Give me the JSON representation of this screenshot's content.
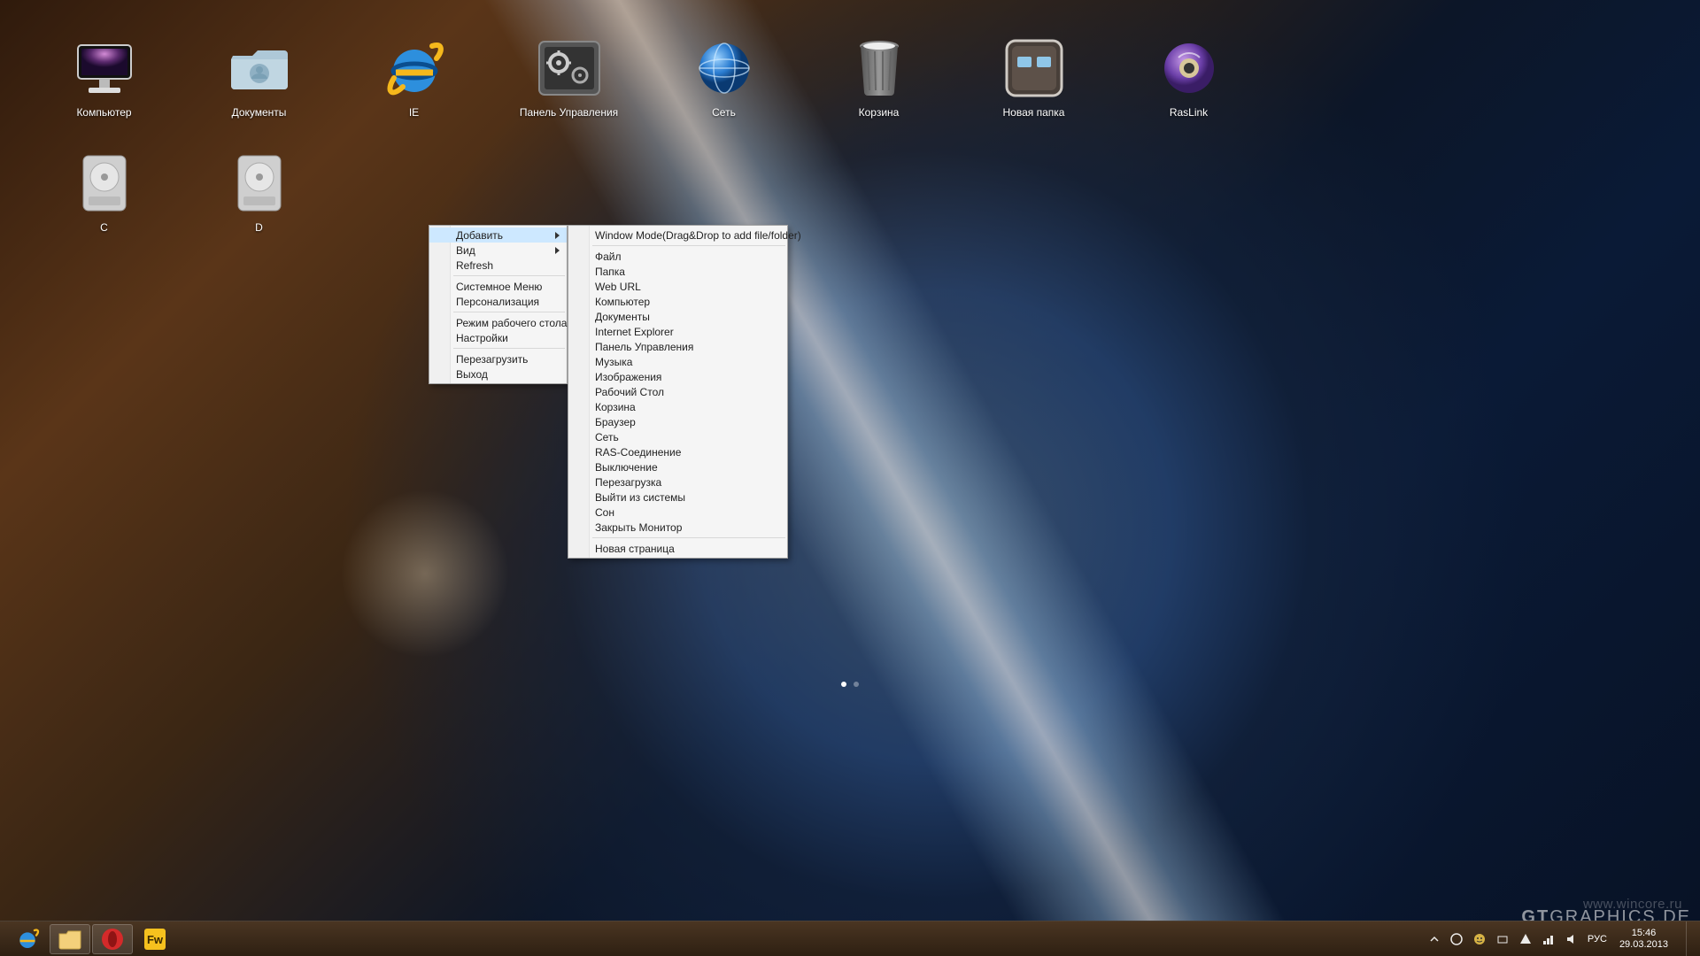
{
  "desktop_icons": {
    "row1": [
      {
        "name": "computer",
        "label": "Компьютер"
      },
      {
        "name": "documents",
        "label": "Документы"
      },
      {
        "name": "ie",
        "label": "IE"
      },
      {
        "name": "control-panel",
        "label": "Панель Управления"
      },
      {
        "name": "network",
        "label": "Сеть"
      },
      {
        "name": "trash",
        "label": "Корзина"
      },
      {
        "name": "new-folder",
        "label": "Новая папка"
      },
      {
        "name": "raslink",
        "label": "RasLink"
      }
    ],
    "row2": [
      {
        "name": "drive-c",
        "label": "C"
      },
      {
        "name": "drive-d",
        "label": "D"
      }
    ]
  },
  "context_menu": {
    "items": [
      {
        "label": "Добавить",
        "submenu": true,
        "highlight": true
      },
      {
        "label": "Вид",
        "submenu": true
      },
      {
        "label": "Refresh"
      },
      {
        "sep": true
      },
      {
        "label": "Системное Меню"
      },
      {
        "label": "Персонализация"
      },
      {
        "sep": true
      },
      {
        "label": "Режим рабочего стола"
      },
      {
        "label": "Настройки"
      },
      {
        "sep": true
      },
      {
        "label": "Перезагрузить"
      },
      {
        "label": "Выход"
      }
    ]
  },
  "submenu": {
    "items": [
      {
        "label": "Window Mode(Drag&Drop to add file/folder)"
      },
      {
        "sep": true
      },
      {
        "label": "Файл"
      },
      {
        "label": "Папка"
      },
      {
        "label": "Web URL"
      },
      {
        "label": "Компьютер"
      },
      {
        "label": "Документы"
      },
      {
        "label": "Internet Explorer"
      },
      {
        "label": "Панель Управления"
      },
      {
        "label": "Музыка"
      },
      {
        "label": "Изображения"
      },
      {
        "label": "Рабочий Стол"
      },
      {
        "label": "Корзина"
      },
      {
        "label": "Браузер"
      },
      {
        "label": "Сеть"
      },
      {
        "label": "RAS-Соединение"
      },
      {
        "label": "Выключение"
      },
      {
        "label": "Перезагрузка"
      },
      {
        "label": "Выйти из системы"
      },
      {
        "label": "Сон"
      },
      {
        "label": "Закрыть Монитор"
      },
      {
        "sep": true
      },
      {
        "label": "Новая страница"
      }
    ]
  },
  "taskbar": {
    "apps": [
      {
        "name": "ie",
        "label": "Internet Explorer"
      },
      {
        "name": "explorer",
        "label": "File Explorer",
        "running": true
      },
      {
        "name": "opera",
        "label": "Opera",
        "running": true
      },
      {
        "name": "fireworks",
        "label": "Fireworks"
      }
    ]
  },
  "tray": {
    "lang": "РУС",
    "time": "15:46",
    "date": "29.03.2013"
  },
  "watermarks": {
    "site": "www.wincore.ru",
    "brand_a": "GT",
    "brand_b": "GRAPHICS",
    "brand_c": ".DE"
  }
}
